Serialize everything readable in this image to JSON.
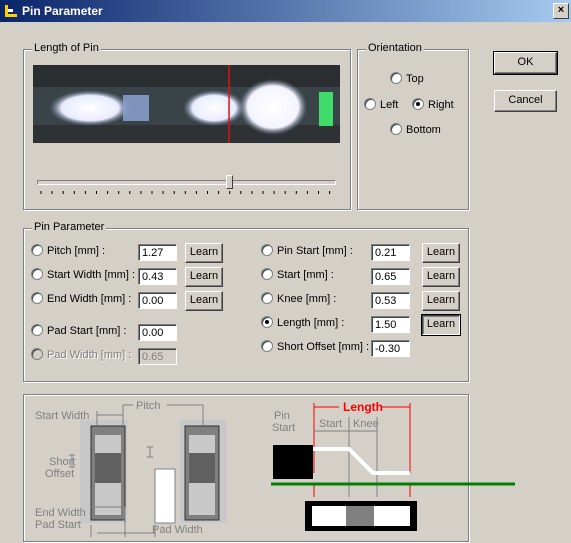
{
  "window": {
    "title": "Pin Parameter",
    "close_label": "×"
  },
  "length_of_pin": {
    "label": "Length of Pin"
  },
  "orientation": {
    "label": "Orientation",
    "options": [
      "Top",
      "Left",
      "Right",
      "Bottom"
    ],
    "selected": "Right"
  },
  "buttons": {
    "ok": "OK",
    "cancel": "Cancel",
    "learn": "Learn"
  },
  "pin_parameter": {
    "label": "Pin Parameter",
    "left": [
      {
        "label": "Pitch [mm] :",
        "value": "1.27"
      },
      {
        "label": "Start Width [mm] :",
        "value": "0.43"
      },
      {
        "label": "End Width [mm] :",
        "value": "0.00"
      },
      {
        "label": "Pad Start [mm] :",
        "value": "0.00"
      },
      {
        "label": "Pad Width [mm] :",
        "value": "0.65"
      }
    ],
    "right": [
      {
        "label": "Pin Start [mm] :",
        "value": "0.21"
      },
      {
        "label": "Start [mm] :",
        "value": "0.65"
      },
      {
        "label": "Knee [mm] :",
        "value": "0.53"
      },
      {
        "label": "Length [mm] :",
        "value": "1.50"
      },
      {
        "label": "Short Offset [mm] :",
        "value": "-0.30"
      }
    ],
    "selected": "Length [mm] :"
  },
  "slider": {
    "position_fraction": 0.645
  },
  "diagram": {
    "start_width": "Start Width",
    "pitch": "Pitch",
    "short": "Short",
    "offset": "Offset",
    "end_width": "End Width",
    "pad_start": "Pad Start",
    "pad_width": "Pad Width",
    "pin": "Pin",
    "pin_start": "Start",
    "length": "Length",
    "start": "Start",
    "knee": "Knee"
  },
  "colors": {
    "highlight": "#ff0000",
    "board": "#008000",
    "title_start": "#0a246a",
    "title_end": "#a6caf0"
  }
}
